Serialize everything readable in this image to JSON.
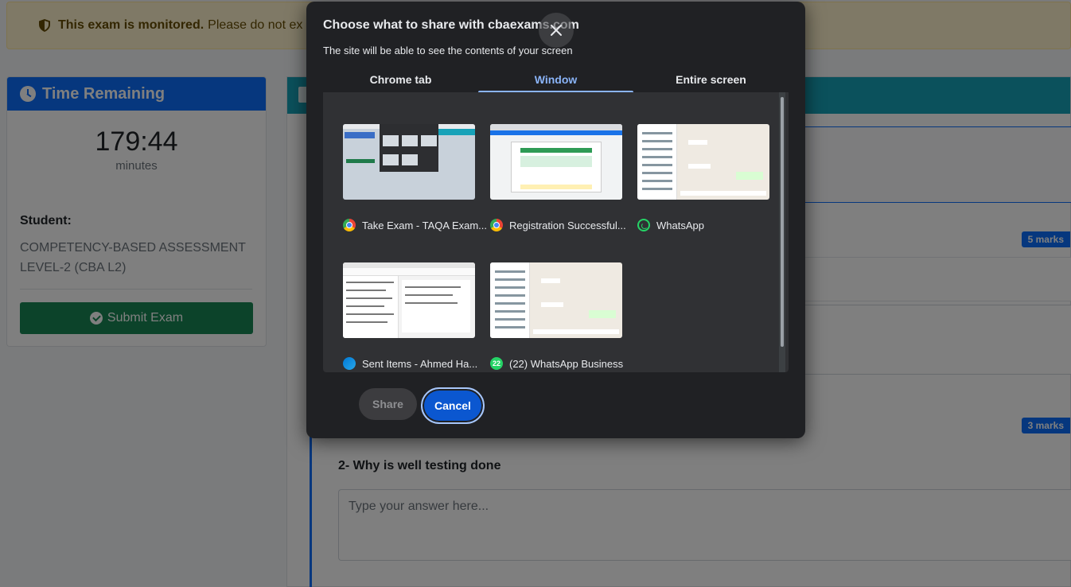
{
  "exam_page": {
    "alert": {
      "strong": "This exam is monitored.",
      "text": "Please do not ex"
    },
    "timer": {
      "title": "Time Remaining",
      "value": "179:44",
      "unit": "minutes"
    },
    "student": {
      "label": "Student:",
      "name": "COMPETENCY-BASED ASSESSMENT LEVEL-2 (CBA L2)"
    },
    "submit_label": "Submit Exam",
    "questions": [
      {
        "marks": "5 marks"
      },
      {
        "marks": "3 marks",
        "title": "2- Why is well testing done",
        "placeholder": "Type your answer here..."
      }
    ]
  },
  "share_dialog": {
    "title": "Choose what to share with cbaexams.com",
    "subtitle": "The site will be able to see the contents of your screen",
    "tabs": [
      {
        "label": "Chrome tab",
        "active": false
      },
      {
        "label": "Window",
        "active": true
      },
      {
        "label": "Entire screen",
        "active": false
      }
    ],
    "windows": [
      {
        "label": "Take Exam - TAQA Exam...",
        "icon": "chrome-icon"
      },
      {
        "label": "Registration Successful...",
        "icon": "chrome-icon"
      },
      {
        "label": "WhatsApp",
        "icon": "whatsapp-icon"
      },
      {
        "label": "Sent Items - Ahmed Ha...",
        "icon": "outlook-icon"
      },
      {
        "label": "(22) WhatsApp Business",
        "icon": "whatsapp-business-icon",
        "badge": "22"
      }
    ],
    "share_label": "Share",
    "cancel_label": "Cancel"
  },
  "colors": {
    "dialog_bg": "#202124",
    "active_tab": "#8ab4f8",
    "cancel_button": "#0b57d0",
    "timer_header": "#0d6efd",
    "submit_button": "#198754"
  }
}
